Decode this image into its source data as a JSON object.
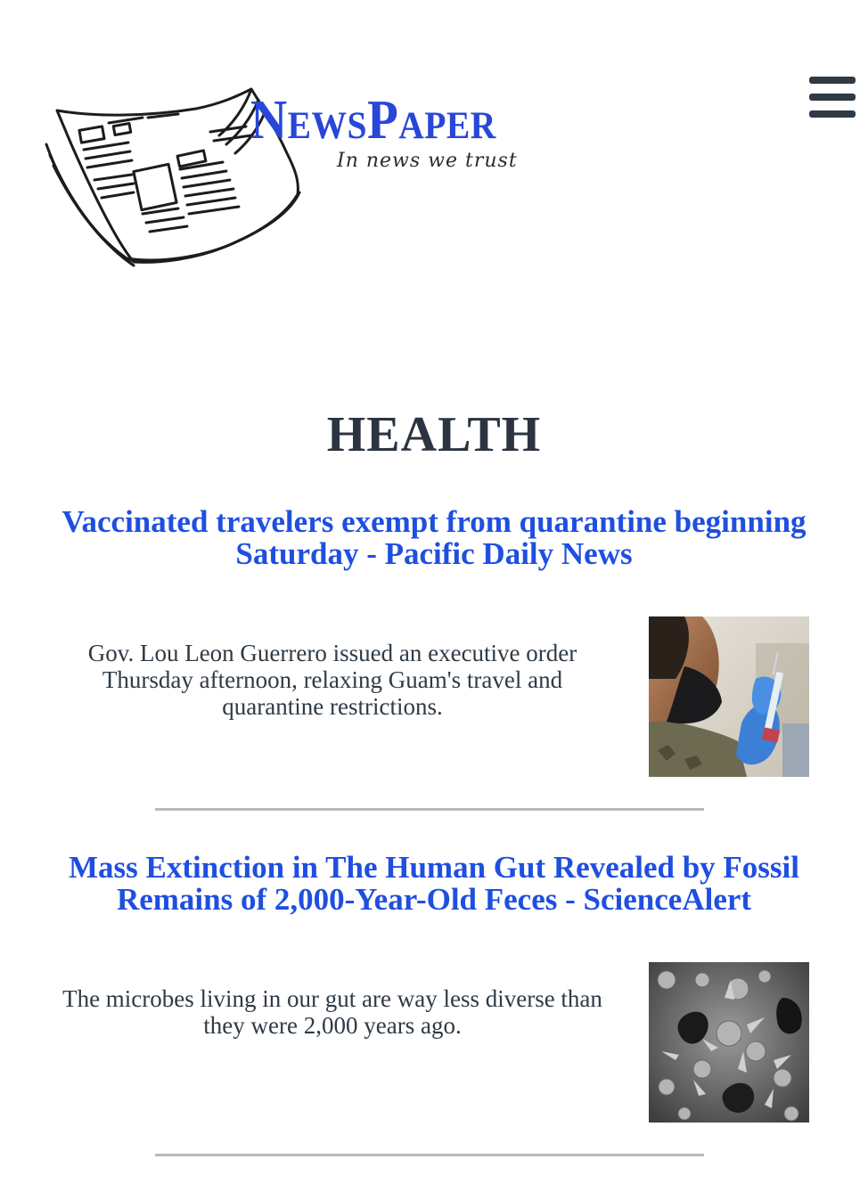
{
  "header": {
    "brand_name": "NewsPaper",
    "tagline": "In news we trust",
    "menu_icon": "hamburger-menu-icon",
    "logo_icon": "newspaper-illustration-icon",
    "brand_color": "#2846d8"
  },
  "section": {
    "title": "HEALTH"
  },
  "articles": [
    {
      "title": "Vaccinated travelers exempt from quarantine beginning Saturday - Pacific Daily News",
      "summary": "Gov. Lou Leon Guerrero issued an executive order Thursday afternoon, relaxing Guam's travel and quarantine restrictions.",
      "image_subject": "vaccine-syringe-photo"
    },
    {
      "title": "Mass Extinction in The Human Gut Revealed by Fossil Remains of 2,000-Year-Old Feces - ScienceAlert",
      "summary": "The microbes living in our gut are way less diverse than they were 2,000 years ago.",
      "image_subject": "microscope-fossil-photo"
    }
  ],
  "colors": {
    "link": "#1f4fe0",
    "text": "#2f3a44",
    "divider": "#b9b9b9"
  }
}
